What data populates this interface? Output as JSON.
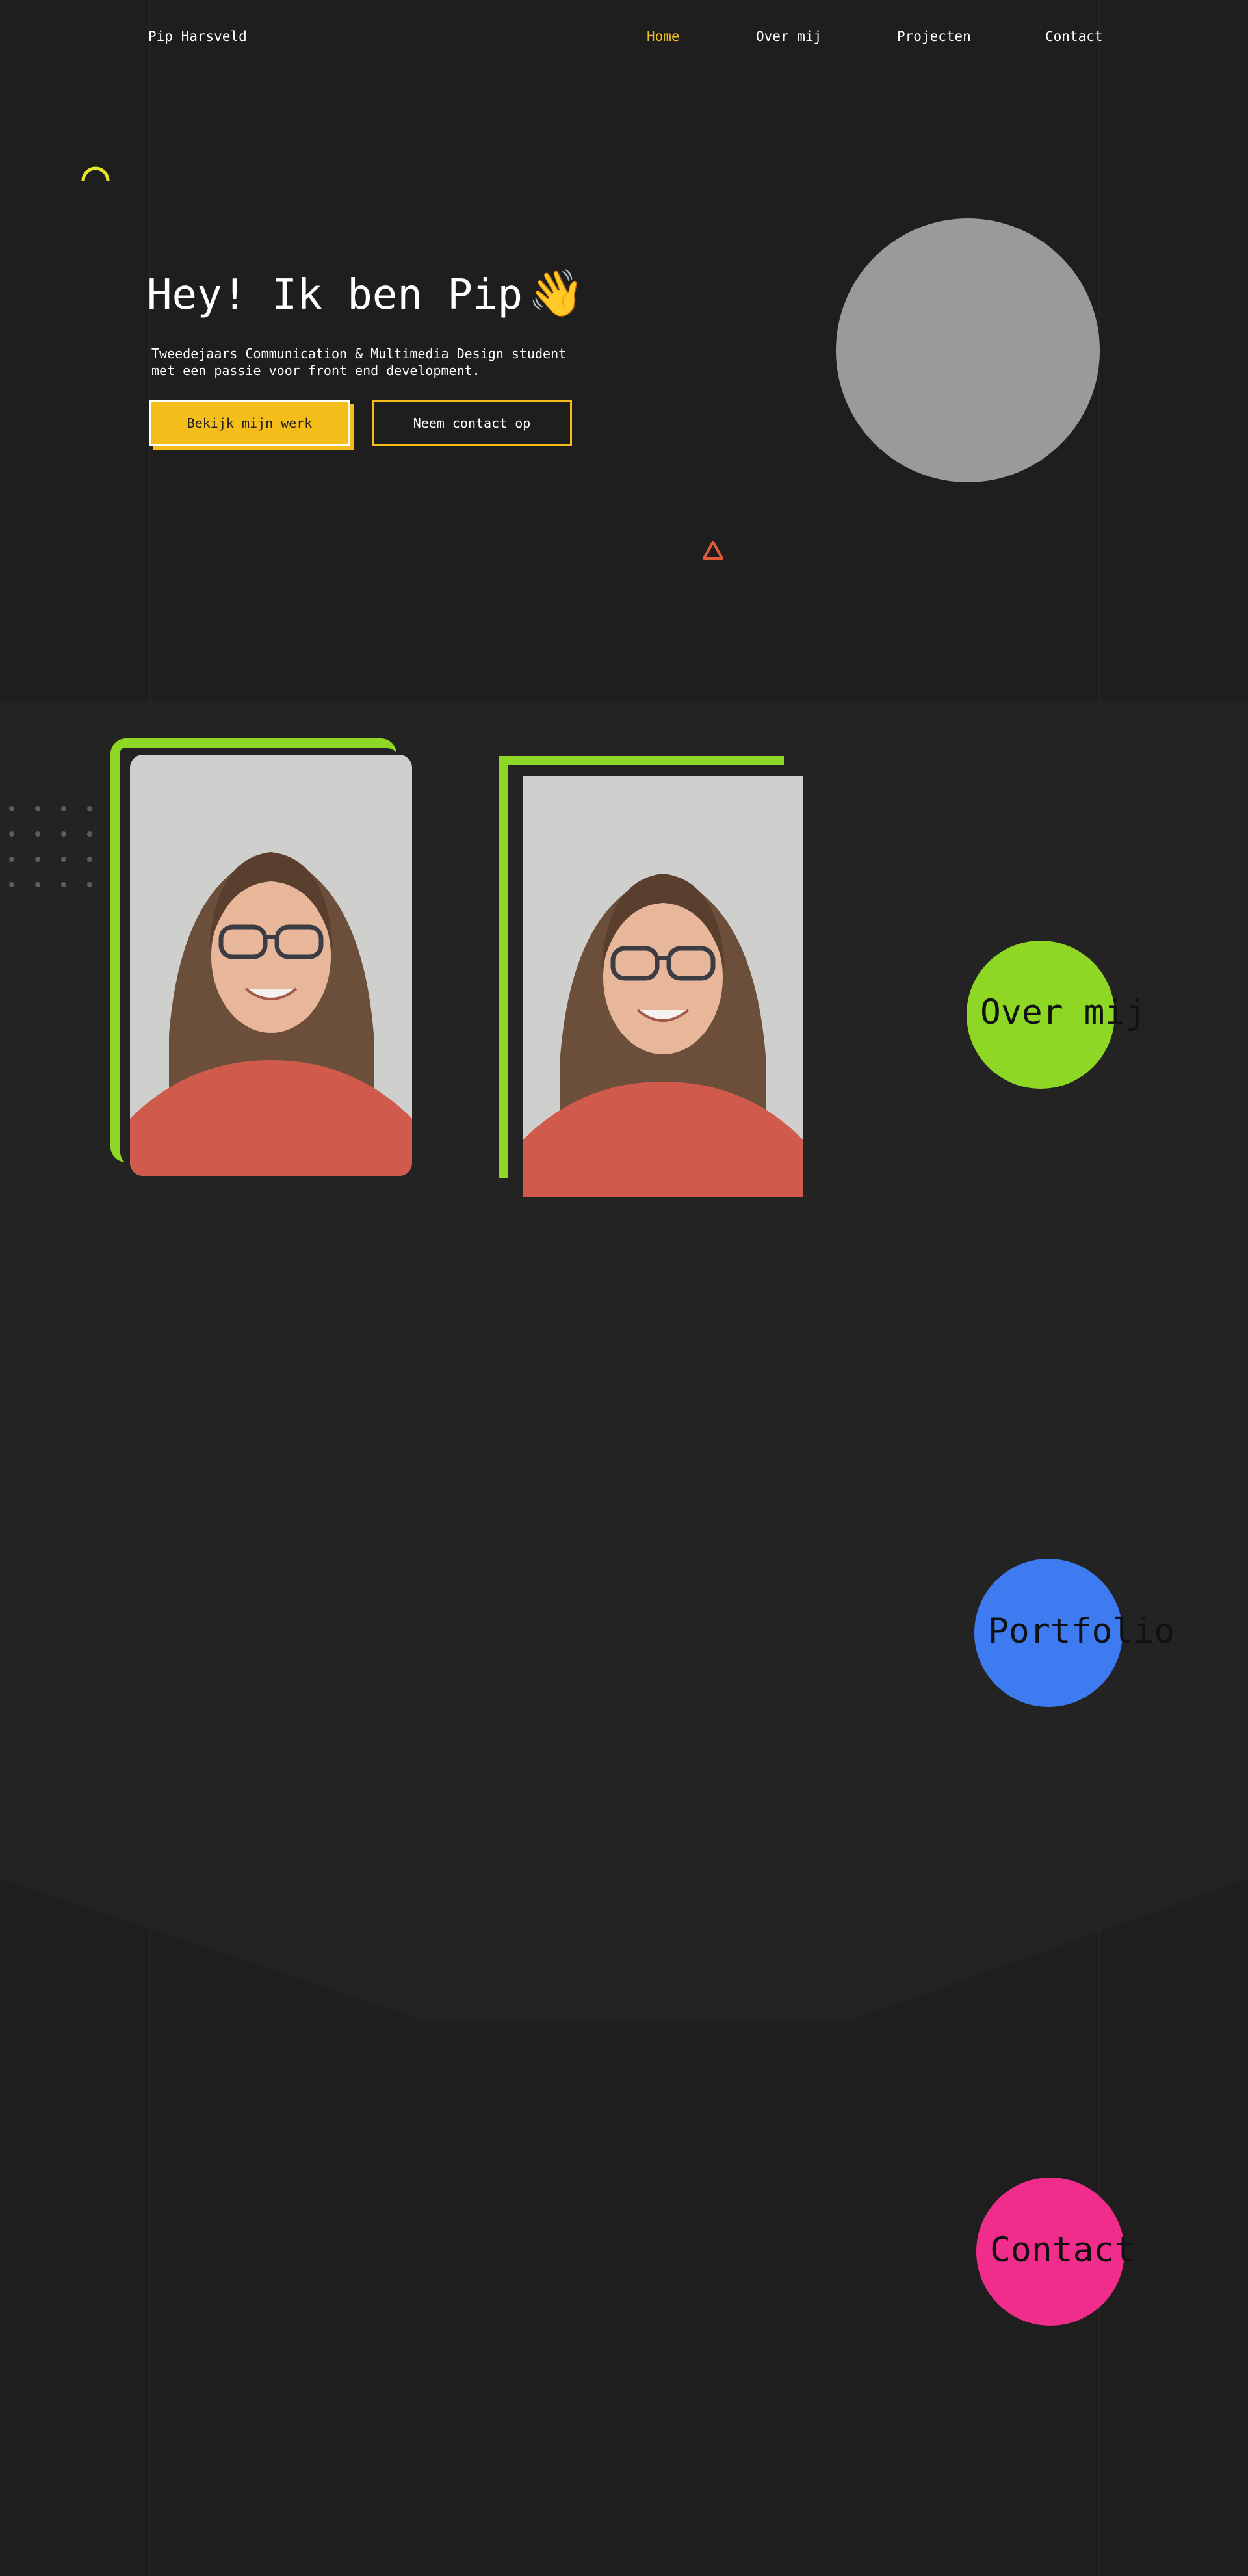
{
  "nav": {
    "brand": "Pip Harsveld",
    "links": [
      {
        "label": "Home",
        "active": true
      },
      {
        "label": "Over mij",
        "active": false
      },
      {
        "label": "Projecten",
        "active": false
      },
      {
        "label": "Contact",
        "active": false
      }
    ]
  },
  "hero": {
    "title": "Hey! Ik ben Pip",
    "title_emoji": "👋",
    "subtitle": "Tweedejaars Communication & Multimedia Design student met een passie voor front end development.",
    "primary_button": "Bekijk mijn werk",
    "secondary_button": "Neem contact op"
  },
  "sections": {
    "about_label": "Over mij",
    "portfolio_label": "Portfolio",
    "contact_label": "Contact"
  },
  "colors": {
    "background": "#1e1e1e",
    "section_bg": "#232323",
    "accent_yellow": "#f4bd1a",
    "accent_green": "#8ed724",
    "accent_blue": "#3f7bf0",
    "accent_pink": "#f02d8a",
    "placeholder_gray": "#9a9a9a",
    "triangle_red": "#e05a3a"
  },
  "icons": {
    "wave": "waving-hand-icon",
    "arc": "arc-shape-icon",
    "triangle": "triangle-outline-icon"
  }
}
